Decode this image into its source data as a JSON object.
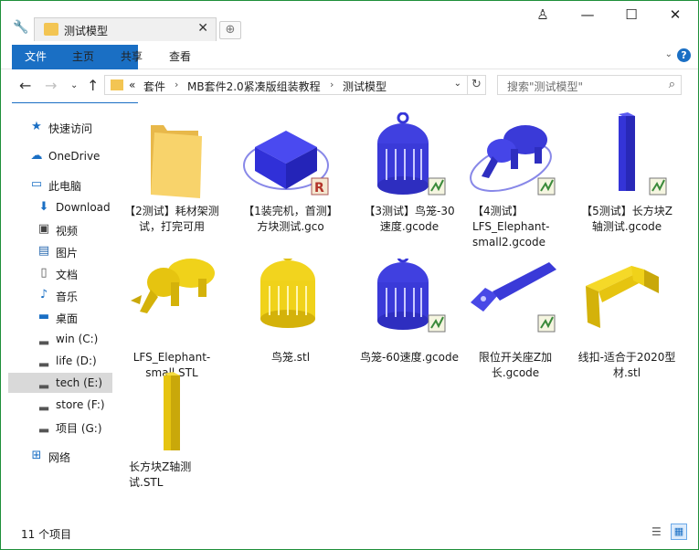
{
  "window": {
    "tab_title": "测试模型",
    "tab_close": "✕",
    "newtab_glyph": "⊕",
    "minimize_glyph": "—",
    "maximize_glyph": "☐",
    "close_glyph": "✕",
    "user_glyph": "♙"
  },
  "ribbon": {
    "tabs": [
      "文件",
      "主页",
      "共享",
      "查看"
    ],
    "help": "?"
  },
  "address": {
    "overflow": "«",
    "crumbs": [
      "套件",
      "MB套件2.0紧凑版组装教程",
      "测试模型"
    ],
    "sep": "›"
  },
  "search": {
    "placeholder": "搜索\"测试模型\""
  },
  "sidebar": {
    "items": [
      {
        "label": "快速访问",
        "icon": "star-icon"
      },
      {
        "label": "OneDrive",
        "icon": "cloud-icon"
      },
      {
        "label": "此电脑",
        "icon": "computer-icon"
      },
      {
        "label": "Download",
        "icon": "download-icon"
      },
      {
        "label": "视频",
        "icon": "video-icon"
      },
      {
        "label": "图片",
        "icon": "picture-icon"
      },
      {
        "label": "文档",
        "icon": "document-icon"
      },
      {
        "label": "音乐",
        "icon": "music-icon"
      },
      {
        "label": "桌面",
        "icon": "desktop-icon"
      },
      {
        "label": "win (C:)",
        "icon": "drive-icon"
      },
      {
        "label": "life (D:)",
        "icon": "drive-icon"
      },
      {
        "label": "tech (E:)",
        "icon": "drive-icon"
      },
      {
        "label": "store (F:)",
        "icon": "drive-icon"
      },
      {
        "label": "项目 (G:)",
        "icon": "drive-icon"
      },
      {
        "label": "网络",
        "icon": "network-icon"
      }
    ]
  },
  "files": [
    {
      "name": "【2测试】耗材架测试，打完可用",
      "kind": "folder"
    },
    {
      "name": "【1装完机，首测】方块测试.gco",
      "kind": "gcode-cube"
    },
    {
      "name": "【3测试】鸟笼-30速度.gcode",
      "kind": "gcode-cage"
    },
    {
      "name": "【4测试】LFS_Elephant-small2.gcode",
      "kind": "gcode-elephant"
    },
    {
      "name": "【5测试】长方块Z轴测试.gcode",
      "kind": "gcode-pillar"
    },
    {
      "name": "LFS_Elephant-small.STL",
      "kind": "stl-elephant"
    },
    {
      "name": "鸟笼.stl",
      "kind": "stl-cage"
    },
    {
      "name": "鸟笼-60速度.gcode",
      "kind": "gcode-cage"
    },
    {
      "name": "限位开关座Z加长.gcode",
      "kind": "gcode-mount"
    },
    {
      "name": "线扣-适合于2020型材.stl",
      "kind": "stl-clip"
    },
    {
      "name": "长方块Z轴测试.STL",
      "kind": "stl-pillar"
    }
  ],
  "status": {
    "count": "11 个项目"
  },
  "colors": {
    "accent": "#1a6fc4",
    "gcode_blue": "#3a3adf",
    "stl_yellow": "#f0d21a",
    "folder": "#f3c553"
  }
}
